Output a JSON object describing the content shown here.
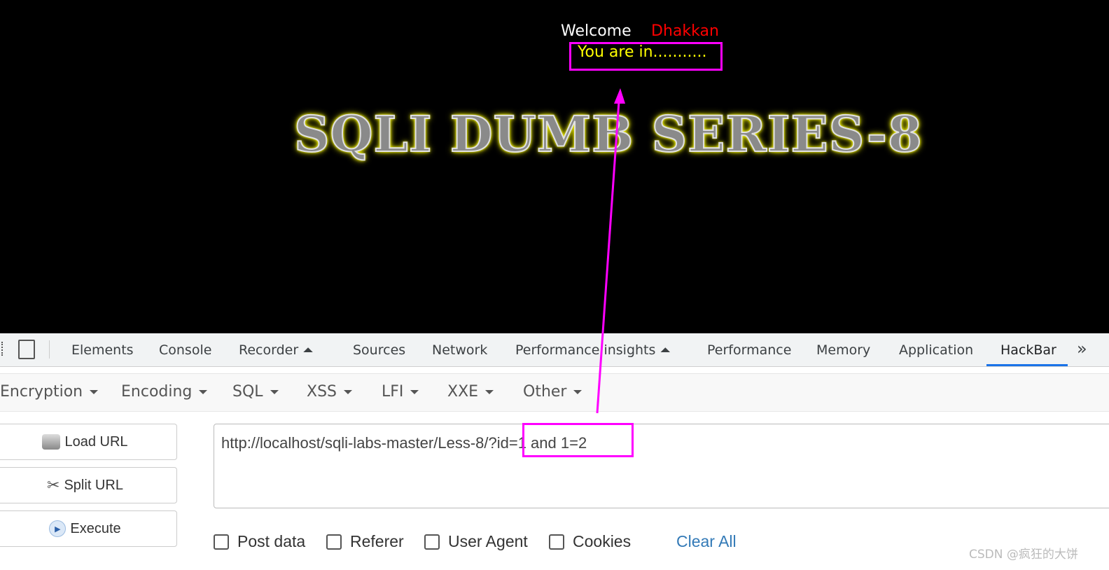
{
  "page": {
    "welcome": "Welcome",
    "user": "Dhakkan",
    "message": "You are in...........",
    "title": "SQLI DUMB SERIES-8"
  },
  "devtools": {
    "tabs": [
      "Elements",
      "Console",
      "Recorder",
      "Sources",
      "Network",
      "Performance insights",
      "Performance",
      "Memory",
      "Application",
      "HackBar"
    ],
    "active": "HackBar",
    "more": "»"
  },
  "hackbar": {
    "menus": [
      "Encryption",
      "Encoding",
      "SQL",
      "XSS",
      "LFI",
      "XXE",
      "Other"
    ],
    "buttons": {
      "load": "Load URL",
      "split": "Split URL",
      "execute": "Execute"
    },
    "url": "http://localhost/sqli-labs-master/Less-8/?id=1 and 1=2",
    "options": [
      "Post data",
      "Referer",
      "User Agent",
      "Cookies"
    ],
    "clear": "Clear All"
  },
  "watermark": "CSDN @疯狂的大饼",
  "colors": {
    "annotation": "#ff00ff",
    "accent": "#1a73e8"
  }
}
